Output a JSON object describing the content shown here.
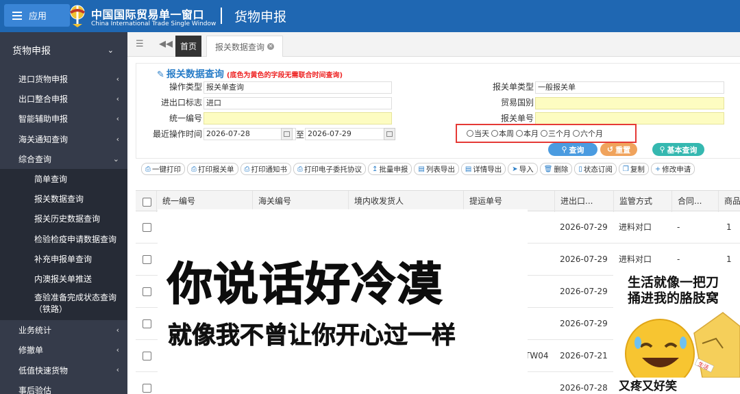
{
  "header": {
    "app_label": "应用",
    "brand_cn": "中国国际贸易单一窗口",
    "brand_en": "China International Trade Single Window",
    "title": "货物申报"
  },
  "sidebar": {
    "top": "货物申报",
    "items": [
      {
        "label": "进口货物申报"
      },
      {
        "label": "出口整合申报"
      },
      {
        "label": "智能辅助申报"
      },
      {
        "label": "海关通知查询"
      },
      {
        "label": "综合查询"
      }
    ],
    "subitems": [
      "简单查询",
      "报关数据查询",
      "报关历史数据查询",
      "检验检疫申请数据查询",
      "补充申报单查询",
      "内澳报关单推送",
      "查验准备完成状态查询（铁路）"
    ],
    "items_after": [
      {
        "label": "业务统计"
      },
      {
        "label": "修撤单"
      },
      {
        "label": "低值快速货物"
      },
      {
        "label": "事后验估"
      }
    ]
  },
  "tabs": {
    "home": "首页",
    "active": "报关数据查询"
  },
  "search": {
    "title": "报关数据查询",
    "note": "(底色为黄色的字段无需联合时间查询)",
    "op_type_label": "操作类型",
    "op_type_value": "报关单查询",
    "ie_flag_label": "进出口标志",
    "ie_flag_value": "进口",
    "unified_no_label": "统一编号",
    "unified_no_value": "",
    "last_op_time_label": "最近操作时间",
    "date_from": "2026-07-28",
    "date_to_label": "至",
    "date_to": "2026-07-29",
    "decl_type_label": "报关单类型",
    "decl_type_value": "一般报关单",
    "trade_country_label": "贸易国别",
    "trade_country_value": "",
    "decl_no_label": "报关单号",
    "decl_no_value": "",
    "radios": [
      "当天",
      "本周",
      "本月",
      "三个月",
      "六个月"
    ],
    "btn_query": "查询",
    "btn_reset": "重置",
    "btn_basic": "基本查询",
    "colors": {
      "query": "#4a9be0",
      "reset": "#f0a35c",
      "basic": "#35b8b0"
    }
  },
  "toolbar": [
    "一键打印",
    "打印报关单",
    "打印通知书",
    "打印电子委托协议",
    "批量申报",
    "列表导出",
    "详情导出",
    "导入",
    "删除",
    "状态订阅",
    "复制",
    "修改申请"
  ],
  "table": {
    "headers": [
      "统一编号",
      "海关编号",
      "境内收发货人",
      "提运单号",
      "进出口...",
      "监管方式",
      "合同...",
      "商品"
    ],
    "rows": [
      {
        "date": "2026-07-29",
        "mode": "进料对口",
        "contract": "-",
        "qty": "1",
        "bill": ""
      },
      {
        "date": "2026-07-29",
        "mode": "进料对口",
        "contract": "-",
        "qty": "1",
        "bill": ""
      },
      {
        "date": "2026-07-29",
        "mode": "",
        "contract": "",
        "qty": "",
        "bill": ""
      },
      {
        "date": "2026-07-29",
        "mode": "",
        "contract": "",
        "qty": "",
        "bill": ""
      },
      {
        "date": "2026-07-21",
        "mode": "",
        "contract": "",
        "qty": "",
        "bill": "TW04"
      },
      {
        "date": "2026-07-28",
        "mode": "",
        "contract": "",
        "qty": "",
        "bill": ""
      }
    ]
  },
  "meme": {
    "big": "你说话好冷漠",
    "small": "就像我不曾让你开心过一样",
    "side_line1": "生活就像一把刀",
    "side_line2": "捅进我的胳肢窝",
    "bottom": "又疼又好笑",
    "tag": "生活"
  }
}
